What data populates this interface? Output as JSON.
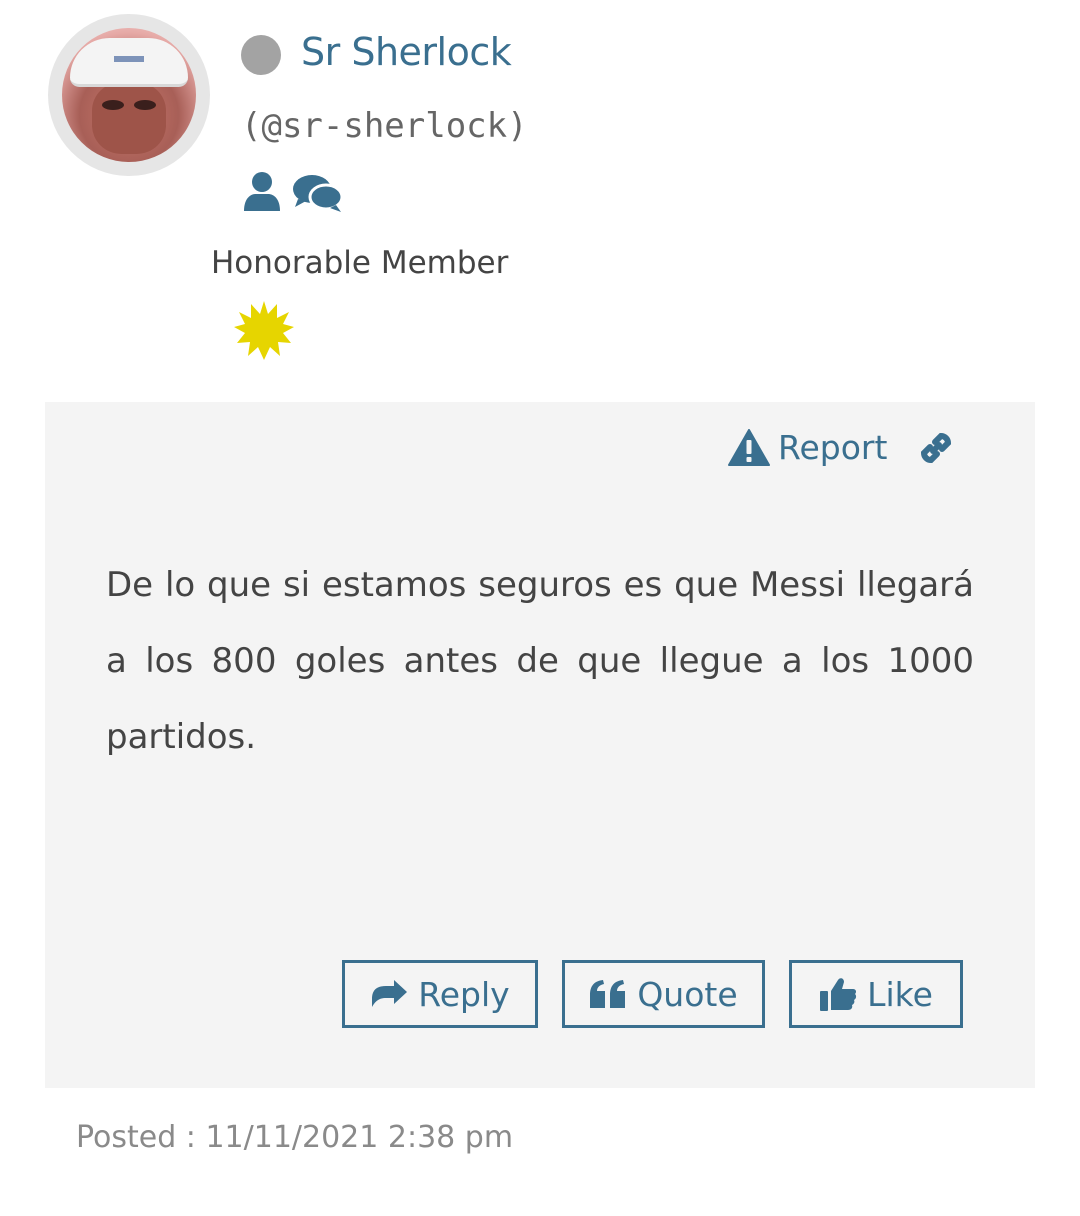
{
  "author": {
    "name": "Sr Sherlock",
    "handle": "(@sr-sherlock)",
    "status": "offline",
    "rank": "Honorable Member",
    "icons": [
      "profile-icon",
      "chat-bubbles-icon"
    ],
    "badge_icon": "sun-badge-icon"
  },
  "post_actions": {
    "report_label": "Report",
    "report_icon": "warning-icon",
    "permalink_icon": "link-icon"
  },
  "post": {
    "text": "De lo que si estamos seguros es que Messi llegará a los 800 goles antes de que llegue a los 1000 partidos."
  },
  "buttons": {
    "reply": "Reply",
    "quote": "Quote",
    "like": "Like"
  },
  "meta": {
    "posted": "Posted : 11/11/2021 2:38 pm"
  },
  "colors": {
    "accent": "#3a6f8f",
    "post_background": "#f4f4f4",
    "status_offline": "#a3a3a3",
    "badge": "#e6d500"
  }
}
